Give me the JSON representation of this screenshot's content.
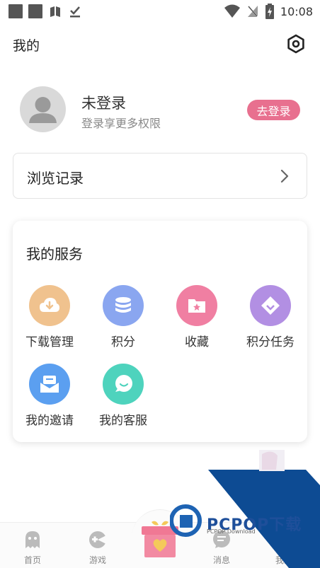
{
  "status_bar": {
    "time": "10:08"
  },
  "header": {
    "title": "我的"
  },
  "profile": {
    "name": "未登录",
    "subtitle": "登录享更多权限",
    "login_label": "去登录"
  },
  "history": {
    "label": "浏览记录"
  },
  "services": {
    "title": "我的服务",
    "items": [
      {
        "label": "下载管理",
        "icon": "download-icon",
        "color": "#f0c28e"
      },
      {
        "label": "积分",
        "icon": "points-icon",
        "color": "#8aa6f0"
      },
      {
        "label": "收藏",
        "icon": "favorite-icon",
        "color": "#f07fa2"
      },
      {
        "label": "积分任务",
        "icon": "tag-icon",
        "color": "#b28fe3"
      },
      {
        "label": "我的邀请",
        "icon": "invite-icon",
        "color": "#5b9ff0"
      },
      {
        "label": "我的客服",
        "icon": "customer-service-icon",
        "color": "#4ed3bd"
      }
    ]
  },
  "bottom_nav": {
    "items": [
      {
        "label": "首页"
      },
      {
        "label": "游戏"
      },
      {
        "label": "消息"
      },
      {
        "label": "我的"
      }
    ]
  },
  "watermark": {
    "brand": "PCPOP下载",
    "sub": "PCPOP Download"
  },
  "colors": {
    "accent": "#e8708f",
    "watermark_blue": "#0d4b93"
  }
}
